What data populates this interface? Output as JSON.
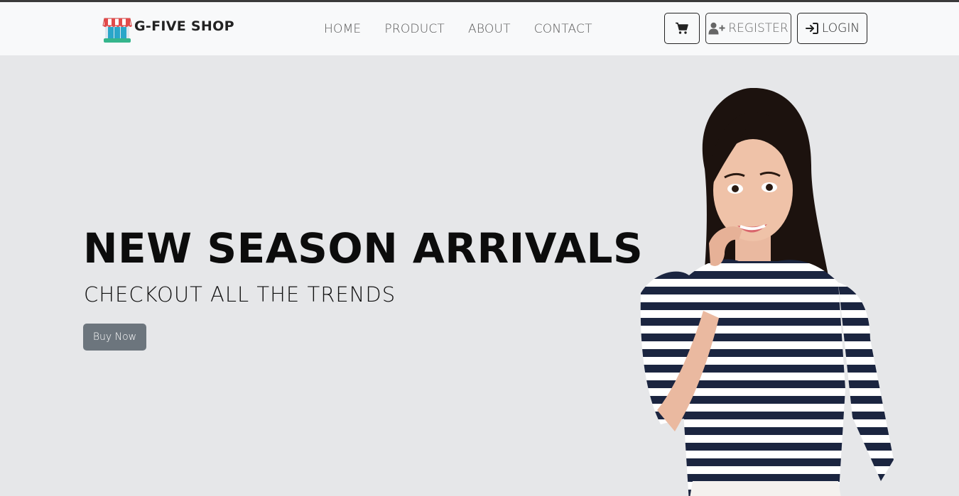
{
  "brand": {
    "name": "G-FIVE SHOP",
    "logo_icon": "storefront-icon"
  },
  "nav": {
    "links": [
      {
        "label": "HOME"
      },
      {
        "label": "PRODUCT"
      },
      {
        "label": "ABOUT"
      },
      {
        "label": "CONTACT"
      }
    ]
  },
  "actions": {
    "cart_icon": "cart-icon",
    "register_label": "REGISTER",
    "register_icon": "user-plus-icon",
    "login_label": "LOGIN",
    "login_icon": "sign-in-icon"
  },
  "hero": {
    "headline": "NEW SEASON ARRIVALS",
    "subheadline": "CHECKOUT ALL THE TRENDS",
    "cta_label": "Buy Now",
    "image_alt": "woman-in-striped-shirt"
  },
  "colors": {
    "navbar_bg": "#f8f9fa",
    "hero_bg": "#e6e7e9",
    "cta_bg": "#6c757d",
    "text_dark": "#0c0c0c"
  }
}
